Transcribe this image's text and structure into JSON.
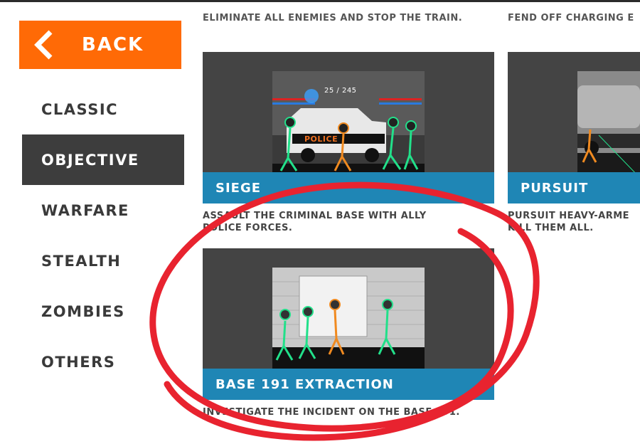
{
  "back_label": "BACK",
  "nav": [
    "CLASSIC",
    "OBJECTIVE",
    "WARFARE",
    "STEALTH",
    "ZOMBIES",
    "OTHERS"
  ],
  "active_nav": "OBJECTIVE",
  "top_descriptions": {
    "left": "ELIMINATE ALL ENEMIES AND STOP THE TRAIN.",
    "right": "FEND OFF CHARGING E"
  },
  "cards": {
    "siege": {
      "title": "SIEGE",
      "ammo": "25 / 245",
      "police_text": "POLICE",
      "desc_line1": "ASSAULT THE CRIMINAL BASE WITH ALLY",
      "desc_line2": "POLICE FORCES."
    },
    "pursuit": {
      "title": "PURSUIT",
      "desc_line1": "PURSUIT HEAVY-ARME",
      "desc_line2": "KILL THEM ALL."
    },
    "base191": {
      "title": "BASE 191 EXTRACTION",
      "desc_line1": "INVESTIGATE THE INCIDENT ON THE BASE 191."
    }
  },
  "colors": {
    "back_button": "#ff6a06",
    "active_nav": "#3d3d3d",
    "card_banner": "#1f86b5",
    "card_bg": "#444444",
    "annotation": "#e8232f"
  }
}
